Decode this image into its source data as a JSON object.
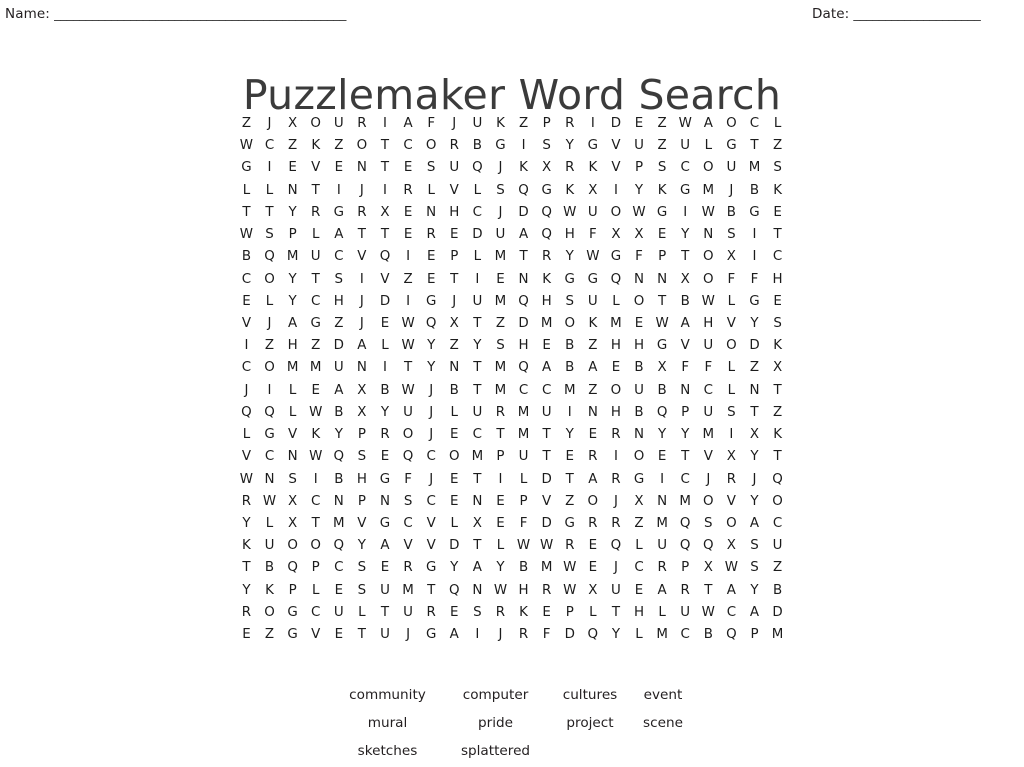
{
  "header": {
    "name_label": "Name:",
    "name_rule": "______________________________________________",
    "date_label": "Date:",
    "date_rule": "____________________"
  },
  "title": "Puzzlemaker Word Search",
  "grid": {
    "rows": 24,
    "cols": 24,
    "letters": [
      [
        "Z",
        "J",
        "X",
        "O",
        "U",
        "R",
        "I",
        "A",
        "F",
        "J",
        "U",
        "K",
        "Z",
        "P",
        "R",
        "I",
        "D",
        "E",
        "Z",
        "W",
        "A",
        "O",
        "C",
        "L"
      ],
      [
        "W",
        "C",
        "Z",
        "K",
        "Z",
        "O",
        "T",
        "C",
        "O",
        "R",
        "B",
        "G",
        "I",
        "S",
        "Y",
        "G",
        "V",
        "U",
        "Z",
        "U",
        "L",
        "G",
        "T",
        "Z"
      ],
      [
        "G",
        "I",
        "E",
        "V",
        "E",
        "N",
        "T",
        "E",
        "S",
        "U",
        "Q",
        "J",
        "K",
        "X",
        "R",
        "K",
        "V",
        "P",
        "S",
        "C",
        "O",
        "U",
        "M",
        "S"
      ],
      [
        "L",
        "L",
        "N",
        "T",
        "I",
        "J",
        "I",
        "R",
        "L",
        "V",
        "L",
        "S",
        "Q",
        "G",
        "K",
        "X",
        "I",
        "Y",
        "K",
        "G",
        "M",
        "J",
        "B",
        "K"
      ],
      [
        "T",
        "T",
        "Y",
        "R",
        "G",
        "R",
        "X",
        "E",
        "N",
        "H",
        "C",
        "J",
        "D",
        "Q",
        "W",
        "U",
        "O",
        "W",
        "G",
        "I",
        "W",
        "B",
        "G",
        "E"
      ],
      [
        "W",
        "S",
        "P",
        "L",
        "A",
        "T",
        "T",
        "E",
        "R",
        "E",
        "D",
        "U",
        "A",
        "Q",
        "H",
        "F",
        "X",
        "X",
        "E",
        "Y",
        "N",
        "S",
        "I",
        "T"
      ],
      [
        "B",
        "Q",
        "M",
        "U",
        "C",
        "V",
        "Q",
        "I",
        "E",
        "P",
        "L",
        "M",
        "T",
        "R",
        "Y",
        "W",
        "G",
        "F",
        "P",
        "T",
        "O",
        "X",
        "I",
        "C"
      ],
      [
        "C",
        "O",
        "Y",
        "T",
        "S",
        "I",
        "V",
        "Z",
        "E",
        "T",
        "I",
        "E",
        "N",
        "K",
        "G",
        "G",
        "Q",
        "N",
        "N",
        "X",
        "O",
        "F",
        "F",
        "H"
      ],
      [
        "E",
        "L",
        "Y",
        "C",
        "H",
        "J",
        "D",
        "I",
        "G",
        "J",
        "U",
        "M",
        "Q",
        "H",
        "S",
        "U",
        "L",
        "O",
        "T",
        "B",
        "W",
        "L",
        "G",
        "E"
      ],
      [
        "V",
        "J",
        "A",
        "G",
        "Z",
        "J",
        "E",
        "W",
        "Q",
        "X",
        "T",
        "Z",
        "D",
        "M",
        "O",
        "K",
        "M",
        "E",
        "W",
        "A",
        "H",
        "V",
        "Y",
        "S"
      ],
      [
        "I",
        "Z",
        "H",
        "Z",
        "D",
        "A",
        "L",
        "W",
        "Y",
        "Z",
        "Y",
        "S",
        "H",
        "E",
        "B",
        "Z",
        "H",
        "H",
        "G",
        "V",
        "U",
        "O",
        "D",
        "K"
      ],
      [
        "C",
        "O",
        "M",
        "M",
        "U",
        "N",
        "I",
        "T",
        "Y",
        "N",
        "T",
        "M",
        "Q",
        "A",
        "B",
        "A",
        "E",
        "B",
        "X",
        "F",
        "F",
        "L",
        "Z",
        "X"
      ],
      [
        "J",
        "I",
        "L",
        "E",
        "A",
        "X",
        "B",
        "W",
        "J",
        "B",
        "T",
        "M",
        "C",
        "C",
        "M",
        "Z",
        "O",
        "U",
        "B",
        "N",
        "C",
        "L",
        "N",
        "T"
      ],
      [
        "Q",
        "Q",
        "L",
        "W",
        "B",
        "X",
        "Y",
        "U",
        "J",
        "L",
        "U",
        "R",
        "M",
        "U",
        "I",
        "N",
        "H",
        "B",
        "Q",
        "P",
        "U",
        "S",
        "T",
        "Z"
      ],
      [
        "L",
        "G",
        "V",
        "K",
        "Y",
        "P",
        "R",
        "O",
        "J",
        "E",
        "C",
        "T",
        "M",
        "T",
        "Y",
        "E",
        "R",
        "N",
        "Y",
        "Y",
        "M",
        "I",
        "X",
        "K"
      ],
      [
        "V",
        "C",
        "N",
        "W",
        "Q",
        "S",
        "E",
        "Q",
        "C",
        "O",
        "M",
        "P",
        "U",
        "T",
        "E",
        "R",
        "I",
        "O",
        "E",
        "T",
        "V",
        "X",
        "Y",
        "T"
      ],
      [
        "W",
        "N",
        "S",
        "I",
        "B",
        "H",
        "G",
        "F",
        "J",
        "E",
        "T",
        "I",
        "L",
        "D",
        "T",
        "A",
        "R",
        "G",
        "I",
        "C",
        "J",
        "R",
        "J",
        "Q"
      ],
      [
        "R",
        "W",
        "X",
        "C",
        "N",
        "P",
        "N",
        "S",
        "C",
        "E",
        "N",
        "E",
        "P",
        "V",
        "Z",
        "O",
        "J",
        "X",
        "N",
        "M",
        "O",
        "V",
        "Y",
        "O"
      ],
      [
        "Y",
        "L",
        "X",
        "T",
        "M",
        "V",
        "G",
        "C",
        "V",
        "L",
        "X",
        "E",
        "F",
        "D",
        "G",
        "R",
        "R",
        "Z",
        "M",
        "Q",
        "S",
        "O",
        "A",
        "C"
      ],
      [
        "K",
        "U",
        "O",
        "O",
        "Q",
        "Y",
        "A",
        "V",
        "V",
        "D",
        "T",
        "L",
        "W",
        "W",
        "R",
        "E",
        "Q",
        "L",
        "U",
        "Q",
        "Q",
        "X",
        "S",
        "U"
      ],
      [
        "T",
        "B",
        "Q",
        "P",
        "C",
        "S",
        "E",
        "R",
        "G",
        "Y",
        "A",
        "Y",
        "B",
        "M",
        "W",
        "E",
        "J",
        "C",
        "R",
        "P",
        "X",
        "W",
        "S",
        "Z"
      ],
      [
        "Y",
        "K",
        "P",
        "L",
        "E",
        "S",
        "U",
        "M",
        "T",
        "Q",
        "N",
        "W",
        "H",
        "R",
        "W",
        "X",
        "U",
        "E",
        "A",
        "R",
        "T",
        "A",
        "Y",
        "B"
      ],
      [
        "R",
        "O",
        "G",
        "C",
        "U",
        "L",
        "T",
        "U",
        "R",
        "E",
        "S",
        "R",
        "K",
        "E",
        "P",
        "L",
        "T",
        "H",
        "L",
        "U",
        "W",
        "C",
        "A",
        "D"
      ],
      [
        "E",
        "Z",
        "G",
        "V",
        "E",
        "T",
        "U",
        "J",
        "G",
        "A",
        "I",
        "J",
        "R",
        "F",
        "D",
        "Q",
        "Y",
        "L",
        "M",
        "C",
        "B",
        "Q",
        "P",
        "M"
      ]
    ]
  },
  "wordlist": {
    "words": [
      "community",
      "computer",
      "cultures",
      "event",
      "mural",
      "pride",
      "project",
      "scene",
      "sketches",
      "splattered",
      "",
      ""
    ]
  }
}
